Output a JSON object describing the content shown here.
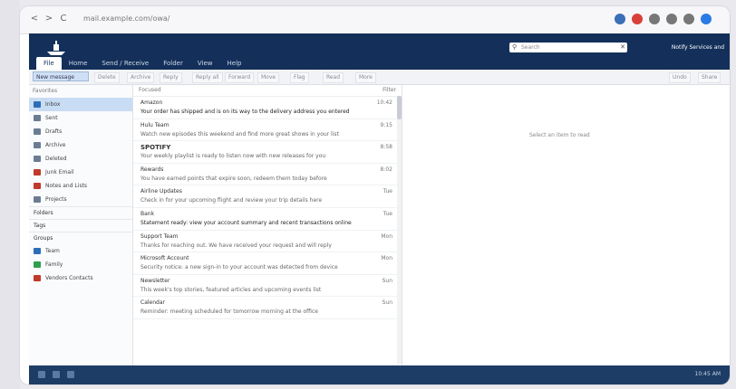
{
  "browser": {
    "url": "mail.example.com/owa/",
    "nav": [
      "<",
      ">",
      "C"
    ],
    "extensions": [
      {
        "name": "shield-icon",
        "color": "#3b6fb6"
      },
      {
        "name": "extension-icon",
        "color": "#d9403a"
      },
      {
        "name": "bookmark-icon",
        "color": "#777"
      },
      {
        "name": "menu-icon",
        "color": "#777"
      },
      {
        "name": "star-icon",
        "color": "#777"
      },
      {
        "name": "profile-icon",
        "color": "#2c7be5"
      }
    ]
  },
  "header": {
    "tabs": [
      "File",
      "Home",
      "Send / Receive",
      "Folder",
      "View",
      "Help"
    ],
    "active_tab": "File",
    "search_placeholder": "Search",
    "user": "Notify Services and"
  },
  "toolbar": {
    "new_label": "New message",
    "buttons": [
      "Delete",
      "Archive",
      "Reply",
      "Reply all",
      "Forward",
      "Move",
      "Flag",
      "Read",
      "More"
    ],
    "right_buttons": [
      "Undo",
      "Share"
    ]
  },
  "folders": {
    "header": "Favorites",
    "items": [
      {
        "label": "Inbox",
        "count": "",
        "color": "#2c6db8",
        "selected": true
      },
      {
        "label": "Sent",
        "color": "#6b7c92"
      },
      {
        "label": "Drafts",
        "color": "#6b7c92"
      },
      {
        "label": "Archive",
        "color": "#6b7c92"
      },
      {
        "label": "Deleted",
        "color": "#6b7c92"
      },
      {
        "label": "Junk Email",
        "color": "#c0392b"
      },
      {
        "label": "Notes and Lists",
        "color": "#c0392b"
      },
      {
        "label": "Projects",
        "color": "#6b7c92"
      }
    ],
    "sections": [
      "Folders",
      "Tags"
    ],
    "groups_header": "Groups",
    "groups": [
      {
        "label": "Team",
        "color": "#2c6db8"
      },
      {
        "label": "Family",
        "color": "#2e9e4f"
      },
      {
        "label": "Vendors Contacts",
        "color": "#c0392b"
      }
    ]
  },
  "list": {
    "header_left": "Focused",
    "header_right": "Filter",
    "messages": [
      {
        "from": "Amazon",
        "subj": "Your order has shipped and is on its way to the delivery address you entered",
        "date": "10:42",
        "bold": false,
        "dark": true
      },
      {
        "from": "Hulu Team",
        "subj": "Watch new episodes this weekend and find more great shows in your list",
        "date": "9:15",
        "bold": false,
        "dark": false
      },
      {
        "from": "SPOTIFY",
        "subj": "Your weekly playlist is ready to listen now with new releases for you",
        "date": "8:58",
        "bold": true,
        "dark": false
      },
      {
        "from": "Rewards",
        "subj": "You have earned points that expire soon, redeem them today before",
        "date": "8:02",
        "bold": false,
        "dark": false
      },
      {
        "from": "Airline Updates",
        "subj": "Check in for your upcoming flight and review your trip details here",
        "date": "Tue",
        "bold": false,
        "dark": false
      },
      {
        "from": "Bank",
        "subj": "Statement ready: view your account summary and recent transactions online",
        "date": "Tue",
        "bold": false,
        "dark": true
      },
      {
        "from": "Support Team",
        "subj": "Thanks for reaching out. We have received your request and will reply",
        "date": "Mon",
        "bold": false,
        "dark": false
      },
      {
        "from": "Microsoft Account",
        "subj": "Security notice: a new sign-in to your account was detected from device",
        "date": "Mon",
        "bold": false,
        "dark": false
      },
      {
        "from": "Newsletter",
        "subj": "This week's top stories, featured articles and upcoming events list",
        "date": "Sun",
        "bold": false,
        "dark": false
      },
      {
        "from": "Calendar",
        "subj": "Reminder: meeting scheduled for tomorrow morning at the office",
        "date": "Sun",
        "bold": false,
        "dark": false
      }
    ]
  },
  "reading": {
    "empty_text": "Select an item to read"
  },
  "taskbar": {
    "time": "10:45 AM"
  }
}
